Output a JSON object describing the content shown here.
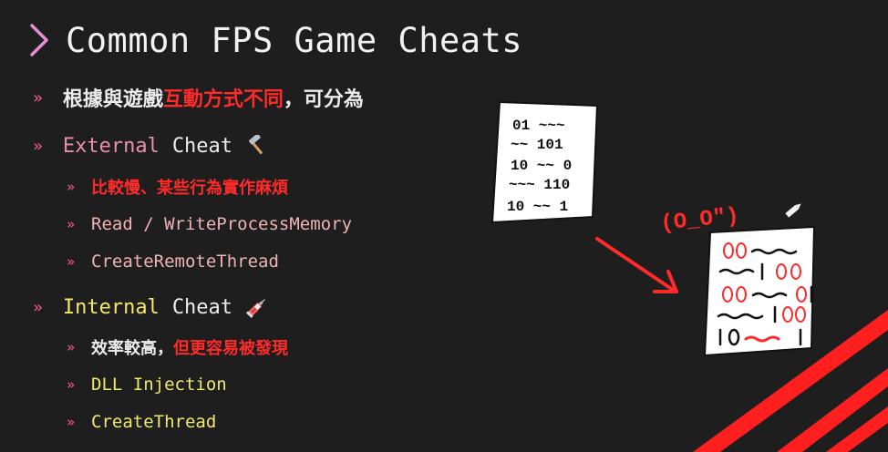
{
  "title": "Common FPS Game Cheats",
  "bullet_marker": "»",
  "intro": {
    "prefix": "根據與遊戲",
    "highlight": "互動方式不同",
    "suffix": "，可分為"
  },
  "external": {
    "label_a": "External",
    "label_b": "Cheat",
    "icon": "hammer-icon",
    "items": [
      {
        "text": "比較慢、某些行為實作麻煩"
      },
      {
        "text": "Read / WriteProcessMemory"
      },
      {
        "text": "CreateRemoteThread"
      }
    ]
  },
  "internal": {
    "label_a": "Internal",
    "label_b": "Cheat",
    "icon": "syringe-icon",
    "items": [
      {
        "prefix": "效率較高，",
        "highlight": "但更容易被發現"
      },
      {
        "text": "DLL Injection"
      },
      {
        "text": "CreateThread"
      }
    ]
  },
  "doodle": {
    "paper_left_rows": [
      "01 ~~~",
      "~~ 101",
      "10 ~~ 0",
      "~~~ 110",
      "10 ~~ 1"
    ],
    "face_text": "(O_O\")",
    "colors": {
      "accent": "#ff2b2b",
      "marker": "#ff5a9a",
      "title": "#f2f2f2",
      "background": "#1e1e1e"
    }
  }
}
